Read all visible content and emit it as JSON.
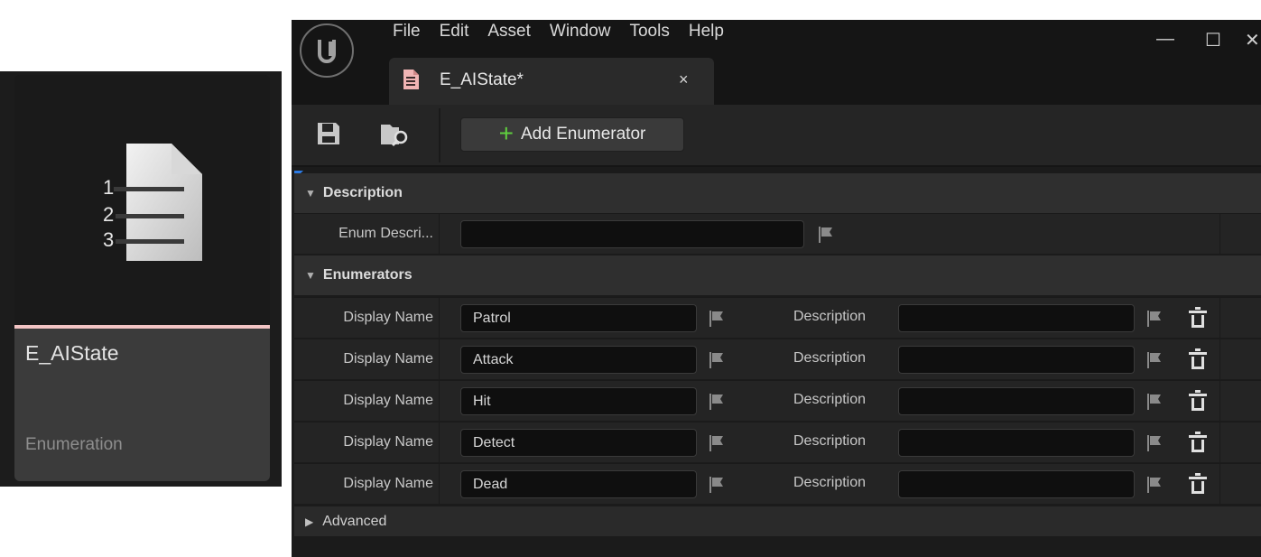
{
  "asset_card": {
    "name": "E_AIState",
    "type": "Enumeration",
    "icon": "numbered-list-document-icon"
  },
  "window": {
    "menu": [
      "File",
      "Edit",
      "Asset",
      "Window",
      "Tools",
      "Help"
    ],
    "tab": {
      "label": "E_AIState*",
      "close": "×"
    },
    "controls": {
      "minimize": "—",
      "maximize": "☐",
      "close": "✕"
    }
  },
  "toolbar": {
    "add_enumerator_label": "Add Enumerator",
    "plus": "+"
  },
  "description_section": {
    "title": "Description",
    "enum_description_label": "Enum Descri...",
    "enum_description_value": ""
  },
  "enumerators_section": {
    "title": "Enumerators",
    "display_name_label": "Display Name",
    "description_label": "Description",
    "items": [
      {
        "display_name": "Patrol",
        "description": ""
      },
      {
        "display_name": "Attack",
        "description": ""
      },
      {
        "display_name": "Hit",
        "description": ""
      },
      {
        "display_name": "Detect",
        "description": ""
      },
      {
        "display_name": "Dead",
        "description": ""
      }
    ]
  },
  "advanced_section": {
    "title": "Advanced"
  },
  "colors": {
    "accent_add": "#5fcf3e",
    "stripe": "#f2c4c4",
    "corner": "#2c7be5"
  }
}
